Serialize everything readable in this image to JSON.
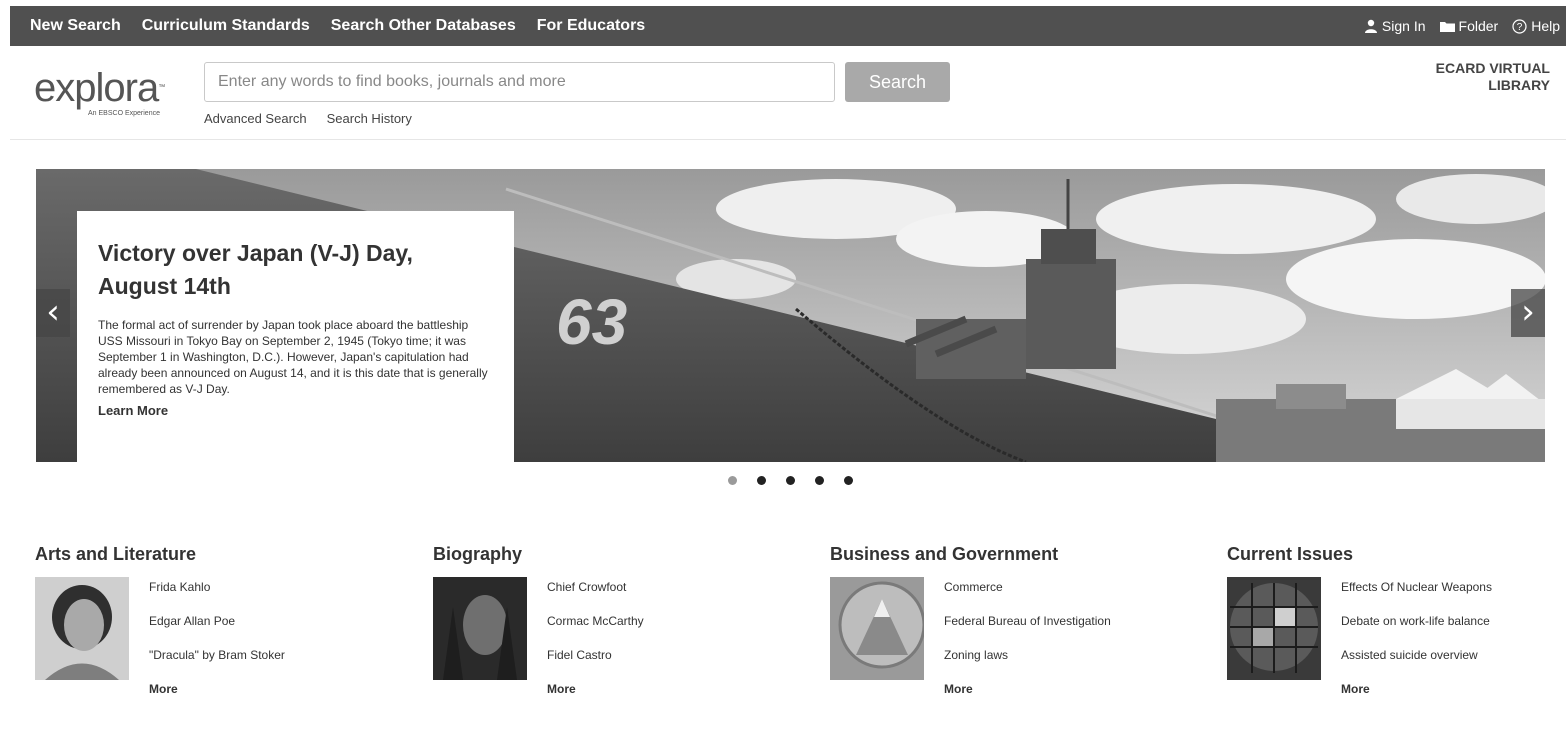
{
  "topnav": {
    "links": [
      "New Search",
      "Curriculum Standards",
      "Search Other Databases",
      "For Educators"
    ],
    "sign_in": "Sign In",
    "folder": "Folder",
    "help": "Help"
  },
  "header": {
    "logo_text": "explora",
    "logo_tagline": "An EBSCO Experience",
    "search_placeholder": "Enter any words to find books, journals and more",
    "search_button": "Search",
    "advanced_search": "Advanced Search",
    "search_history": "Search History",
    "library_line1": "ECARD VIRTUAL",
    "library_line2": "LIBRARY"
  },
  "carousel": {
    "title": "Victory over Japan (V-J) Day, August 14th",
    "body": "The formal act of surrender by Japan took place aboard the battleship USS Missouri in Tokyo Bay on September 2, 1945 (Tokyo time; it was September 1 in Washington, D.C.). However, Japan's capitulation had already been announced on August 14, and it is this date that is generally remembered as V-J Day.",
    "learn_more": "Learn More",
    "hull_number": "63",
    "slide_count": 5,
    "active_slide": 1
  },
  "categories": [
    {
      "title": "Arts and Literature",
      "items": [
        "Frida Kahlo",
        "Edgar Allan Poe",
        "\"Dracula\" by Bram Stoker"
      ],
      "more": "More"
    },
    {
      "title": "Biography",
      "items": [
        "Chief Crowfoot",
        "Cormac McCarthy",
        "Fidel Castro"
      ],
      "more": "More"
    },
    {
      "title": "Business and Government",
      "items": [
        "Commerce",
        "Federal Bureau of Investigation",
        "Zoning laws"
      ],
      "more": "More"
    },
    {
      "title": "Current Issues",
      "items": [
        "Effects Of Nuclear Weapons",
        "Debate on work-life balance",
        "Assisted suicide overview"
      ],
      "more": "More"
    }
  ]
}
